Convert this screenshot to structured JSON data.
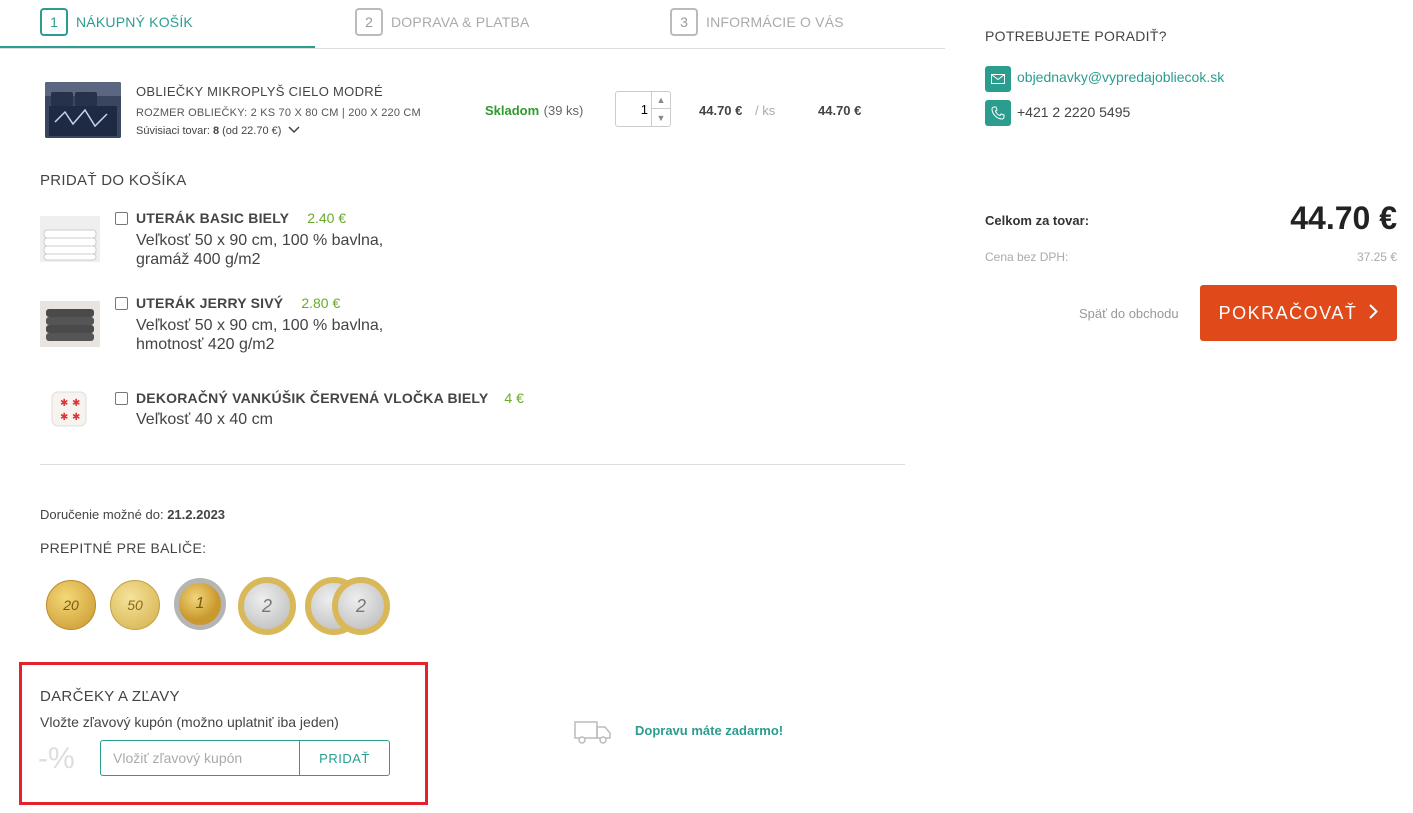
{
  "steps": [
    {
      "num": "1",
      "label": "NÁKUPNÝ KOŠÍK"
    },
    {
      "num": "2",
      "label": "DOPRAVA & PLATBA"
    },
    {
      "num": "3",
      "label": "INFORMÁCIE O VÁS"
    }
  ],
  "cart_item": {
    "name": "OBLIEČKY MIKROPLYŠ CIELO MODRÉ",
    "size_label": "ROZMER OBLIEČKY: 2 KS 70 X 80 CM | 200 X 220 CM",
    "related_label": "Súvisiaci tovar:",
    "related_count": "8",
    "related_from": "(od 22.70 €)",
    "stock_status": "Skladom",
    "stock_count": "(39 ks)",
    "quantity": "1",
    "unit_price": "44.70 €",
    "unit_suffix": "/ ks",
    "total_price": "44.70 €"
  },
  "add_to_cart": {
    "title": "PRIDAŤ DO KOŠÍKA",
    "items": [
      {
        "name": "UTERÁK BASIC BIELY",
        "price": "2.40 €",
        "desc1": "Veľkosť 50 x 90 cm, 100 % bavlna,",
        "desc2": "gramáž 400 g/m2"
      },
      {
        "name": "UTERÁK JERRY SIVÝ",
        "price": "2.80 €",
        "desc1": "Veľkosť 50 x 90 cm, 100 % bavlna,",
        "desc2": "hmotnosť 420 g/m2"
      },
      {
        "name": "DEKORAČNÝ VANKÚŠIK ČERVENÁ VLOČKA BIELY",
        "price": "4 €",
        "desc1": "Veľkosť 40 x 40 cm"
      }
    ]
  },
  "delivery": {
    "label": "Doručenie možné do:",
    "date": "21.2.2023"
  },
  "tip": {
    "title": "PREPITNÉ PRE BALIČE:",
    "coins": [
      {
        "label": "20"
      },
      {
        "label": "50"
      },
      {
        "label": "1"
      },
      {
        "label": "2"
      },
      {
        "label": "2"
      }
    ]
  },
  "coupon": {
    "title": "DARČEKY A ZĽAVY",
    "subtitle": "Vložte zľavový kupón (možno uplatniť iba jeden)",
    "percent_symbol": "-%",
    "placeholder": "Vložiť zľavový kupón",
    "button": "PRIDAŤ"
  },
  "shipping": {
    "text": "Dopravu máte zadarmo!"
  },
  "help": {
    "title": "POTREBUJETE PORADIŤ?",
    "email": "objednavky@vypredajobliecok.sk",
    "phone": "+421 2 2220 5495"
  },
  "summary": {
    "total_label": "Celkom za tovar:",
    "total_value": "44.70 €",
    "net_label": "Cena bez DPH:",
    "net_value": "37.25 €",
    "back_link": "Späť do obchodu",
    "continue_button": "POKRAČOVAŤ"
  },
  "colors": {
    "accent": "#2a9d8f",
    "cta": "#e04a1b",
    "coupon_highlight": "#e3222e",
    "addon_price": "#6aaa2a",
    "in_stock": "#2e9b2e"
  }
}
